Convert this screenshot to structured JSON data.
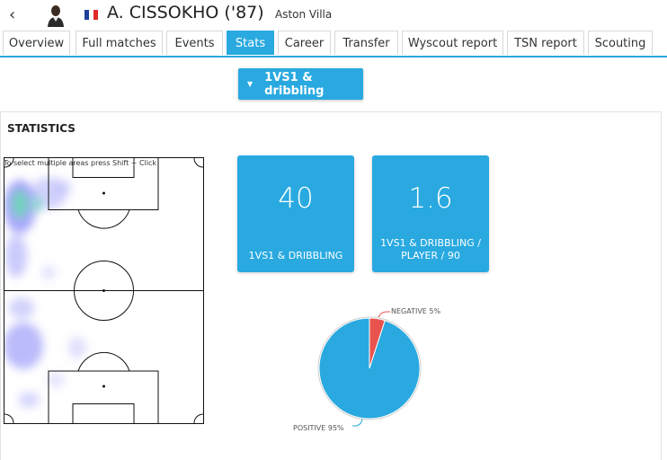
{
  "header": {
    "back_icon": "chevron-left-icon",
    "player_name": "A. CISSOKHO ('87)",
    "club": "Aston Villa",
    "flag_colors": [
      "#1f3f9a",
      "#ffffff",
      "#e02a2a"
    ]
  },
  "tabs": [
    {
      "label": "Overview",
      "active": false
    },
    {
      "label": "Full matches",
      "active": false
    },
    {
      "label": "Events",
      "active": false
    },
    {
      "label": "Stats",
      "active": true
    },
    {
      "label": "Career",
      "active": false
    },
    {
      "label": "Transfer",
      "active": false
    },
    {
      "label": "Wyscout report",
      "active": false
    },
    {
      "label": "TSN report",
      "active": false
    },
    {
      "label": "Scouting",
      "active": false
    }
  ],
  "dropdown": {
    "label": "1VS1 & dribbling",
    "caret_icon": "caret-down-icon"
  },
  "stats": {
    "title": "STATISTICS",
    "pitch_hint": "To select multiple areas press Shift + Click",
    "cards": [
      {
        "value": "40",
        "label": "1VS1 & DRIBBLING"
      },
      {
        "value": "1.6",
        "label": "1VS1 & DRIBBLING / PLAYER / 90"
      }
    ]
  },
  "chart_data": {
    "type": "pie",
    "slices": [
      {
        "label": "POSITIVE 95%",
        "value": 95,
        "color": "#29a9e0"
      },
      {
        "label": "NEGATIVE 5%",
        "value": 5,
        "color": "#e8534f"
      }
    ]
  },
  "colors": {
    "accent": "#29a9e0",
    "negative": "#e8534f"
  }
}
